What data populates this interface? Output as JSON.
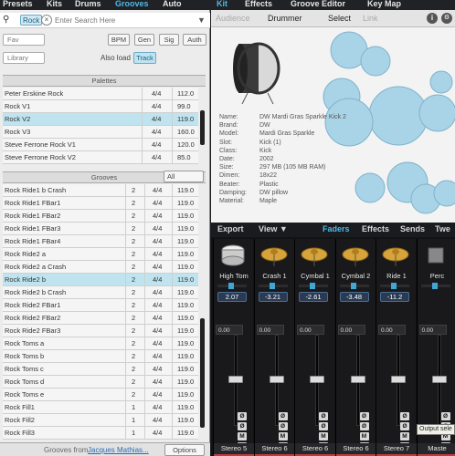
{
  "menu": {
    "items": [
      "Presets",
      "Kits",
      "Drums",
      "Grooves",
      "Auto",
      "Kit",
      "Effects",
      "Groove Editor",
      "Key Map"
    ]
  },
  "search": {
    "tag": "Rock",
    "placeholder": "Enter Search Here"
  },
  "filters": {
    "fav_label": "Fav",
    "library_label": "Library",
    "bpm": "BPM",
    "gen": "Gen",
    "sig": "Sig",
    "auth": "Auth",
    "also_load": "Also load",
    "track": "Track"
  },
  "palettes": {
    "header": "Palettes",
    "rows": [
      {
        "name": "Peter Erskine Rock",
        "sig": "4/4",
        "bpm": "112.0",
        "selected": false
      },
      {
        "name": "Rock V1",
        "sig": "4/4",
        "bpm": "99.0",
        "selected": false
      },
      {
        "name": "Rock V2",
        "sig": "4/4",
        "bpm": "119.0",
        "selected": true
      },
      {
        "name": "Rock V3",
        "sig": "4/4",
        "bpm": "160.0",
        "selected": false
      },
      {
        "name": "Steve Ferrone Rock V1",
        "sig": "4/4",
        "bpm": "120.0",
        "selected": false
      },
      {
        "name": "Steve Ferrone Rock V2",
        "sig": "4/4",
        "bpm": "85.0",
        "selected": false
      }
    ]
  },
  "grooves": {
    "header": "Grooves",
    "all": "All",
    "rows": [
      {
        "name": "Rock Ride1 b Crash",
        "n": "2",
        "sig": "4/4",
        "bpm": "119.0",
        "selected": false
      },
      {
        "name": "Rock Ride1 FBar1",
        "n": "2",
        "sig": "4/4",
        "bpm": "119.0",
        "selected": false
      },
      {
        "name": "Rock Ride1 FBar2",
        "n": "2",
        "sig": "4/4",
        "bpm": "119.0",
        "selected": false
      },
      {
        "name": "Rock Ride1 FBar3",
        "n": "2",
        "sig": "4/4",
        "bpm": "119.0",
        "selected": false
      },
      {
        "name": "Rock Ride1 FBar4",
        "n": "2",
        "sig": "4/4",
        "bpm": "119.0",
        "selected": false
      },
      {
        "name": "Rock Ride2 a",
        "n": "2",
        "sig": "4/4",
        "bpm": "119.0",
        "selected": false
      },
      {
        "name": "Rock Ride2 a Crash",
        "n": "2",
        "sig": "4/4",
        "bpm": "119.0",
        "selected": false
      },
      {
        "name": "Rock Ride2 b",
        "n": "2",
        "sig": "4/4",
        "bpm": "119.0",
        "selected": true
      },
      {
        "name": "Rock Ride2 b Crash",
        "n": "2",
        "sig": "4/4",
        "bpm": "119.0",
        "selected": false
      },
      {
        "name": "Rock Ride2 FBar1",
        "n": "2",
        "sig": "4/4",
        "bpm": "119.0",
        "selected": false
      },
      {
        "name": "Rock Ride2 FBar2",
        "n": "2",
        "sig": "4/4",
        "bpm": "119.0",
        "selected": false
      },
      {
        "name": "Rock Ride2 FBar3",
        "n": "2",
        "sig": "4/4",
        "bpm": "119.0",
        "selected": false
      },
      {
        "name": "Rock Toms a",
        "n": "2",
        "sig": "4/4",
        "bpm": "119.0",
        "selected": false
      },
      {
        "name": "Rock Toms b",
        "n": "2",
        "sig": "4/4",
        "bpm": "119.0",
        "selected": false
      },
      {
        "name": "Rock Toms c",
        "n": "2",
        "sig": "4/4",
        "bpm": "119.0",
        "selected": false
      },
      {
        "name": "Rock Toms d",
        "n": "2",
        "sig": "4/4",
        "bpm": "119.0",
        "selected": false
      },
      {
        "name": "Rock Toms e",
        "n": "2",
        "sig": "4/4",
        "bpm": "119.0",
        "selected": false
      },
      {
        "name": "Rock Fill1",
        "n": "1",
        "sig": "4/4",
        "bpm": "119.0",
        "selected": false
      },
      {
        "name": "Rock Fill2",
        "n": "1",
        "sig": "4/4",
        "bpm": "119.0",
        "selected": false
      },
      {
        "name": "Rock Fill3",
        "n": "1",
        "sig": "4/4",
        "bpm": "119.0",
        "selected": false
      }
    ],
    "footer_prefix": "Grooves from",
    "footer_link": "Jacques Mathias...",
    "options": "Options"
  },
  "kit_tabs": {
    "audience": "Audience",
    "drummer": "Drummer",
    "select": "Select",
    "link": "Link"
  },
  "drum_info": [
    {
      "label": "Name:",
      "value": "DW Mardi Gras Sparkle Kick 2"
    },
    {
      "label": "Brand:",
      "value": "DW"
    },
    {
      "label": "Model:",
      "value": "Mardi Gras Sparkle"
    },
    {
      "label": "Slot:",
      "value": "Kick (1)"
    },
    {
      "label": "Class:",
      "value": "Kick"
    },
    {
      "label": "Date:",
      "value": "2002"
    },
    {
      "label": "Size:",
      "value": "297 MB (105 MB RAM)"
    },
    {
      "label": "Dimen:",
      "value": "18x22"
    },
    {
      "label": "Beater:",
      "value": "Plastic"
    },
    {
      "label": "Damping:",
      "value": "DW pillow"
    },
    {
      "label": "Material:",
      "value": "Maple"
    }
  ],
  "mixer": {
    "export": "Export",
    "view": "View ▼",
    "faders": "Faders",
    "effects": "Effects",
    "sends": "Sends",
    "twe": "Twe",
    "channels": [
      {
        "name": "High Tom",
        "vol": "2.07",
        "db": "0.00",
        "out": "Stereo 5"
      },
      {
        "name": "Crash 1",
        "vol": "-3.21",
        "db": "0.00",
        "out": "Stereo 6"
      },
      {
        "name": "Cymbal 1",
        "vol": "-2.61",
        "db": "0.00",
        "out": "Stereo 6"
      },
      {
        "name": "Cymbal 2",
        "vol": "-3.48",
        "db": "0.00",
        "out": "Stereo 6"
      },
      {
        "name": "Ride 1",
        "vol": "-11.2",
        "db": "0.00",
        "out": "Stereo 7"
      },
      {
        "name": "Perc",
        "vol": "",
        "db": "0.00",
        "out": "Maste"
      }
    ],
    "tooltip": "Output sele"
  },
  "colors": {
    "accent": "#3fa7d6",
    "selected_row": "#bfe4f0",
    "kit_circle": "#a9d3e6"
  }
}
